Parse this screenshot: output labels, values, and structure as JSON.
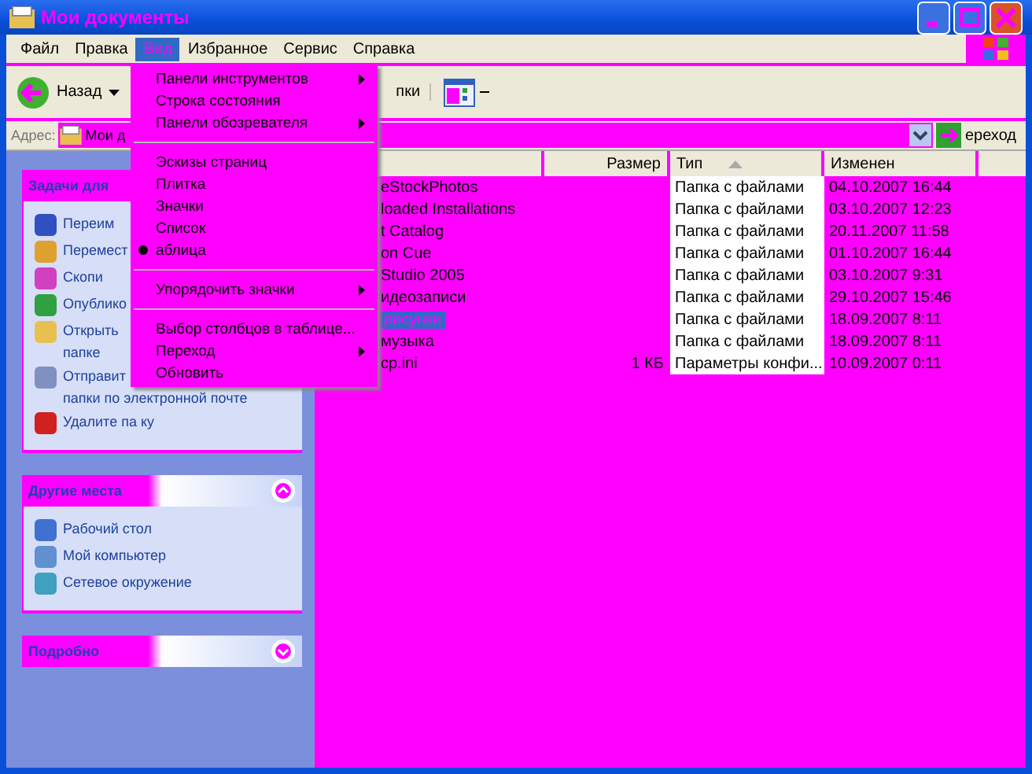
{
  "window": {
    "title": "Мои документы"
  },
  "menu_bar": [
    {
      "label": "Файл",
      "selected": false
    },
    {
      "label": "Правка",
      "selected": false
    },
    {
      "label": "Вид",
      "selected": true
    },
    {
      "label": "Избранное",
      "selected": false
    },
    {
      "label": "Сервис",
      "selected": false
    },
    {
      "label": "Справка",
      "selected": false
    }
  ],
  "view_menu": [
    {
      "label": "Панели инструментов",
      "submenu": true,
      "checked": false,
      "separator_after": false
    },
    {
      "label": "Строка состояния",
      "submenu": false,
      "checked": false,
      "separator_after": false
    },
    {
      "label": "Панели обозревателя",
      "submenu": true,
      "checked": false,
      "separator_after": true
    },
    {
      "label": "Эскизы страниц",
      "submenu": false,
      "checked": false,
      "separator_after": false
    },
    {
      "label": "Плитка",
      "submenu": false,
      "checked": false,
      "separator_after": false
    },
    {
      "label": "Значки",
      "submenu": false,
      "checked": false,
      "separator_after": false
    },
    {
      "label": "Список",
      "submenu": false,
      "checked": false,
      "separator_after": false
    },
    {
      "label": "аблица",
      "submenu": false,
      "checked": true,
      "separator_after": true
    },
    {
      "label": "Упорядочить значки",
      "submenu": true,
      "checked": false,
      "separator_after": true
    },
    {
      "label": "Выбор столбцов в таблице...",
      "submenu": false,
      "checked": false,
      "separator_after": false
    },
    {
      "label": "Переход",
      "submenu": true,
      "checked": false,
      "separator_after": false
    },
    {
      "label": "Обновить",
      "submenu": false,
      "checked": false,
      "separator_after": false
    }
  ],
  "toolbar": {
    "back": "Назад",
    "folders": "пки"
  },
  "address_bar": {
    "label": "Адрес:",
    "value": "Мои д",
    "go": "ереход"
  },
  "tasks_panel": {
    "title": "Задачи для",
    "items": [
      {
        "lines": [
          "Переим"
        ]
      },
      {
        "lines": [
          "Перемест"
        ]
      },
      {
        "lines": [
          "Скопи"
        ]
      },
      {
        "lines": [
          "Опублико"
        ]
      },
      {
        "lines": [
          "Открыть",
          "папке"
        ]
      },
      {
        "lines": [
          "Отправит",
          "папки по электронной почте"
        ]
      },
      {
        "lines": [
          "Удалите па ку"
        ]
      }
    ]
  },
  "places_panel": {
    "title": "Другие места",
    "items": [
      {
        "label": "Рабочий стол"
      },
      {
        "label": "Мой компьютер"
      },
      {
        "label": "Сетевое окружение"
      }
    ]
  },
  "details_panel": {
    "title": "Подробно"
  },
  "table": {
    "columns": [
      "Размер",
      "Тип",
      "Изменен"
    ],
    "rows": [
      {
        "name": "eStockPhotos",
        "type": "Папка с файлами",
        "modified": "04.10.2007 16:44",
        "selected": false
      },
      {
        "name": "loaded Installations",
        "type": "Папка с файлами",
        "modified": "03.10.2007 12:23",
        "selected": false
      },
      {
        "name": "t Catalog",
        "type": "Папка с файлами",
        "modified": "20.11.2007 11:58",
        "selected": false
      },
      {
        "name": "on Cue",
        "type": "Папка с файлами",
        "modified": "01.10.2007 16:44",
        "selected": false
      },
      {
        "name": "Studio 2005",
        "type": "Папка с файлами",
        "modified": "03.10.2007 9:31",
        "selected": false
      },
      {
        "name": "идеозаписи",
        "type": "Папка с файлами",
        "modified": "29.10.2007 15:46",
        "selected": false
      },
      {
        "name": "рисунки",
        "type": "Папка с файлами",
        "modified": "18.09.2007 8:11",
        "selected": true
      },
      {
        "name": "музыка",
        "type": "Папка с файлами",
        "modified": "18.09.2007 8:11",
        "selected": false
      },
      {
        "name": "cp.ini",
        "size": "1 КБ",
        "type": "Параметры конфи...",
        "modified": "10.09.2007 0:11",
        "selected": false
      }
    ]
  }
}
